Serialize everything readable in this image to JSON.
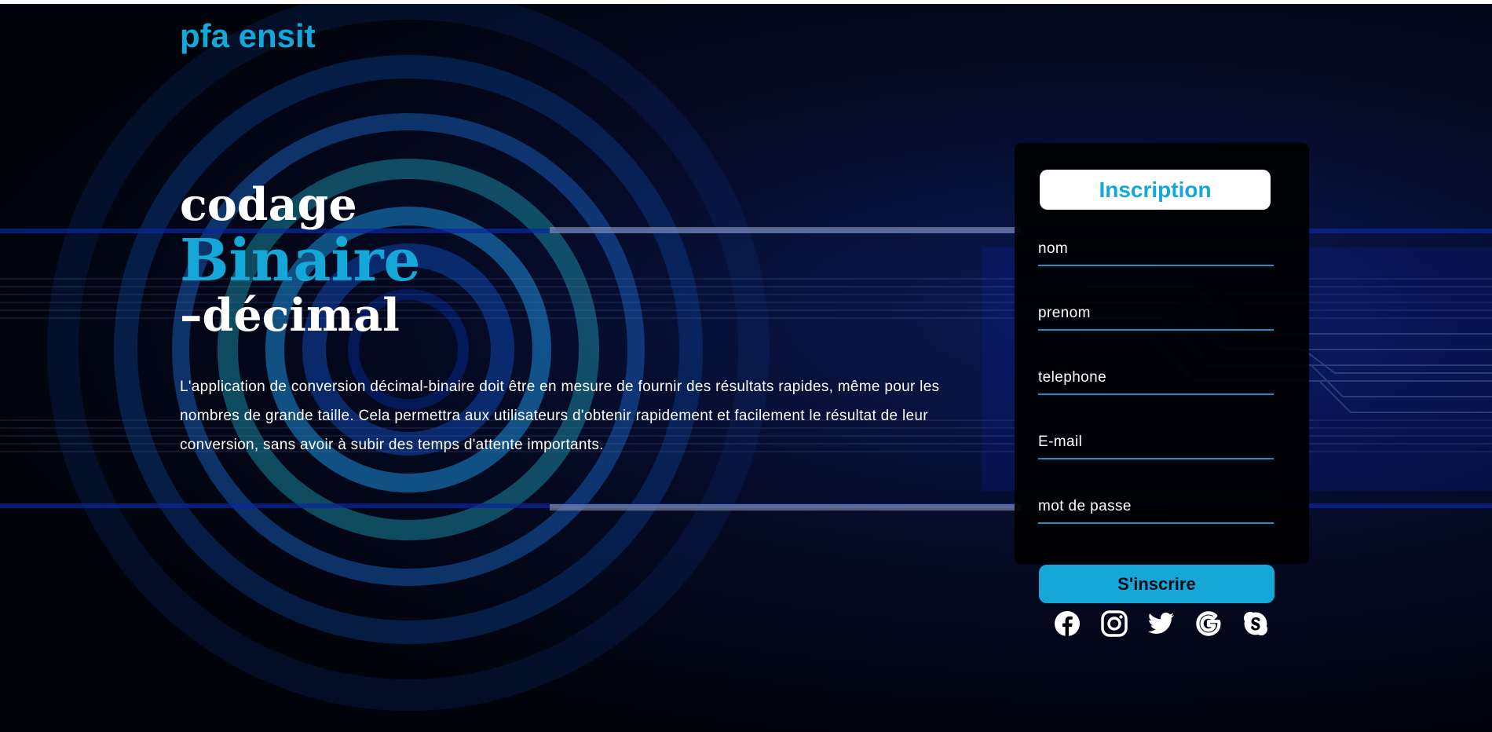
{
  "brand": {
    "name": "pfa ensit"
  },
  "hero": {
    "line1": "codage",
    "line2": "Binaire",
    "line3": "–décimal",
    "description": "L'application de conversion décimal-binaire doit être en mesure de fournir des résultats rapides, même pour les nombres de grande taille. Cela permettra aux utilisateurs d'obtenir rapidement et facilement le résultat de leur conversion, sans avoir à subir des temps d'attente importants."
  },
  "form": {
    "title": "Inscription",
    "fields": [
      {
        "placeholder": "nom"
      },
      {
        "placeholder": "prenom"
      },
      {
        "placeholder": "telephone"
      },
      {
        "placeholder": "E-mail"
      },
      {
        "placeholder": "mot de passe"
      }
    ],
    "submit_label": "S'inscrire"
  },
  "socials": [
    "facebook-icon",
    "instagram-icon",
    "twitter-icon",
    "google-icon",
    "skype-icon"
  ],
  "colors": {
    "accent": "#14a7d8",
    "background": "#02040a",
    "text": "#ffffff"
  }
}
